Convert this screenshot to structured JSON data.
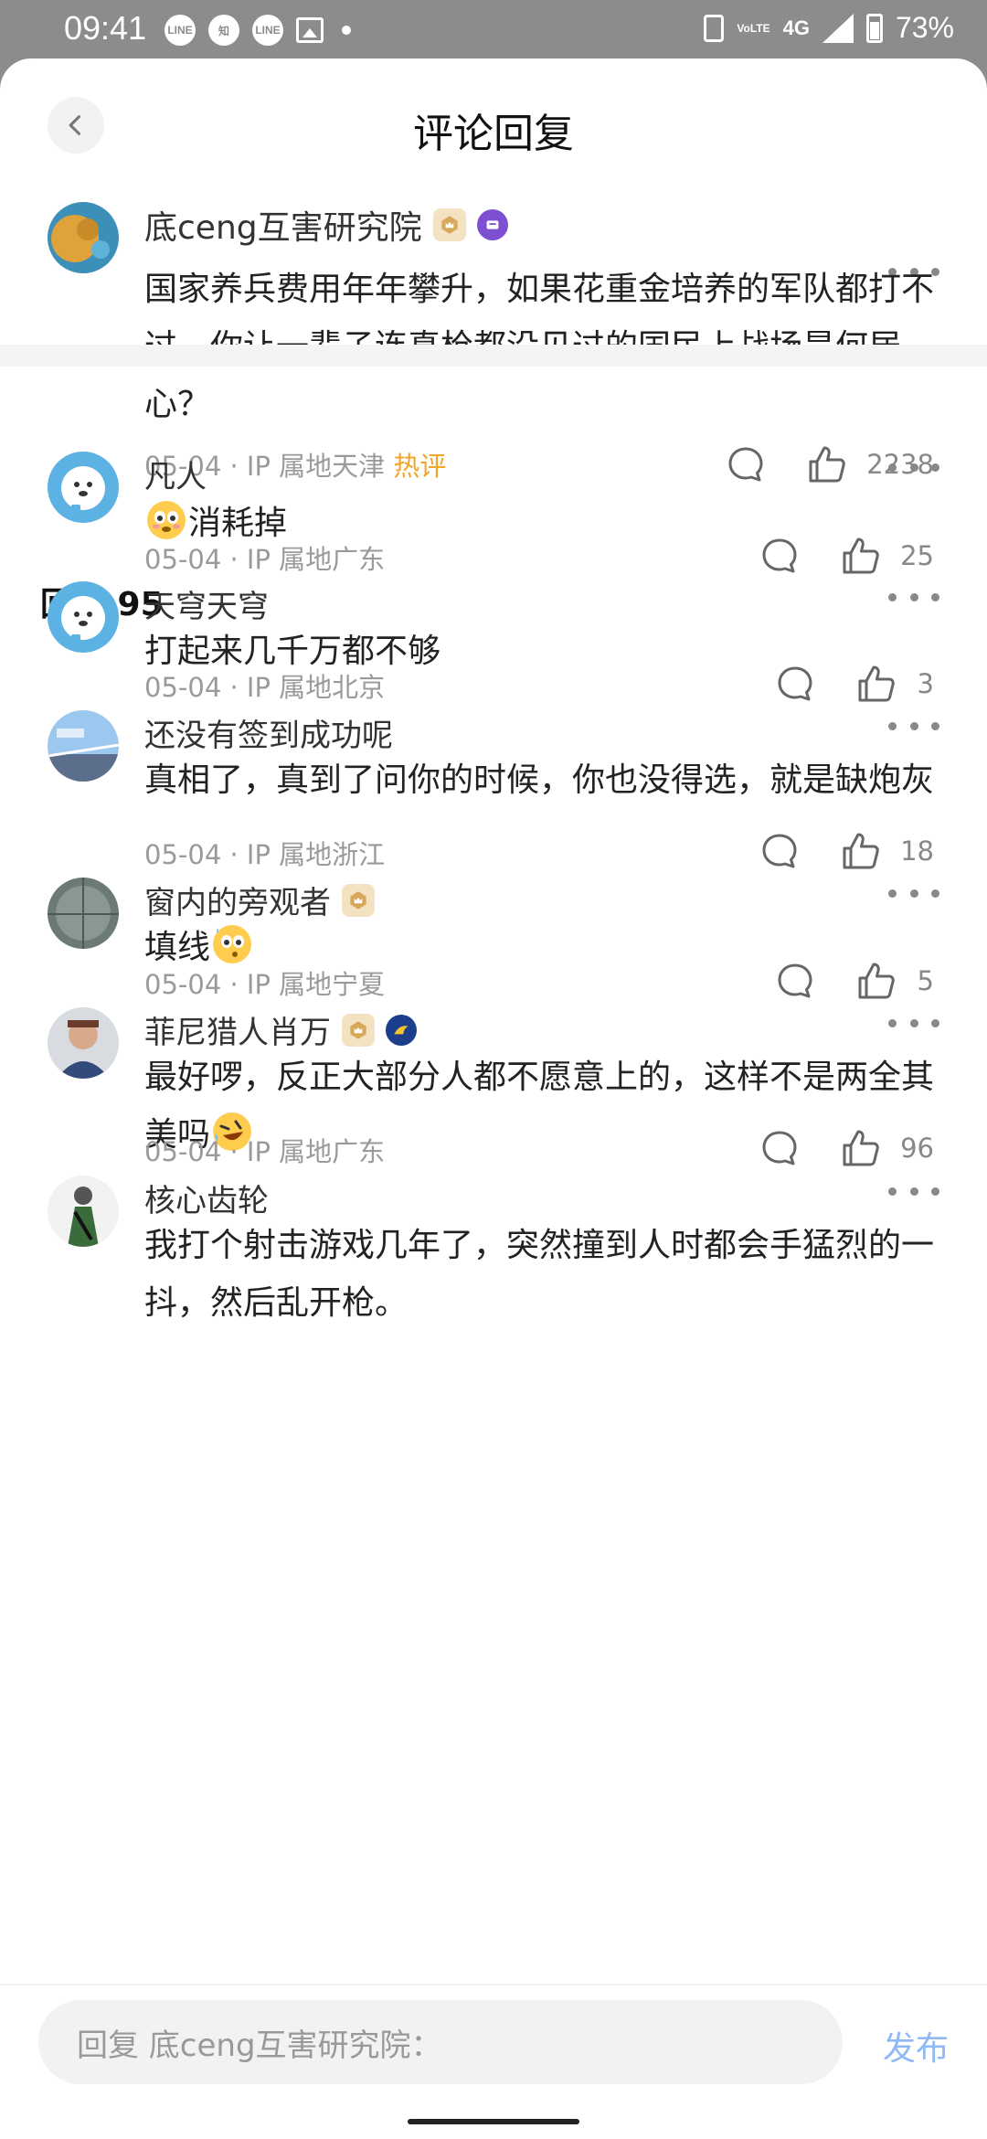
{
  "status_bar": {
    "time": "09:41",
    "apps": [
      "LINE",
      "知",
      "LINE"
    ],
    "network": "4G",
    "network_sub": "VoLTE",
    "battery": "73%"
  },
  "header": {
    "title": "评论回复",
    "back_icon": "chevron-left-icon"
  },
  "main_comment": {
    "author": "底ceng互害研究院",
    "text": "国家养兵费用年年攀升，如果花重金培养的军队都打不过，你让一辈子连真枪都没见过的国民上战场是何居心？",
    "date": "05-04 · IP 属地天津",
    "hot_tag": "热评",
    "likes": "2238"
  },
  "replies_header": {
    "label": "回复 95"
  },
  "replies": [
    {
      "author": "凡人",
      "text": "消耗掉",
      "date": "05-04 · IP 属地广东",
      "likes": "25"
    },
    {
      "author": "天穹天穹",
      "text": "打起来几千万都不够",
      "date": "05-04 · IP 属地北京",
      "likes": "3"
    },
    {
      "author": "还没有签到成功呢",
      "text": "真相了，真到了问你的时候，你也没得选，就是缺炮灰",
      "date": "05-04 · IP 属地浙江",
      "likes": "18"
    },
    {
      "author": "窗内的旁观者",
      "text": "填线",
      "date": "05-04 · IP 属地宁夏",
      "likes": "5"
    },
    {
      "author": "菲尼猎人肖万",
      "text": "最好啰，反正大部分人都不愿意上的，这样不是两全其美吗",
      "date": "05-04 · IP 属地广东",
      "likes": "96"
    },
    {
      "author": "核心齿轮",
      "text": "我打个射击游戏几年了，突然撞到人时都会手猛烈的一抖，然后乱开枪。"
    }
  ],
  "composer": {
    "placeholder": "回复 底ceng互害研究院：",
    "publish_label": "发布"
  },
  "colors": {
    "hot": "#f3a429",
    "publish": "#8fb8f5",
    "meta": "#9a9a9a"
  }
}
